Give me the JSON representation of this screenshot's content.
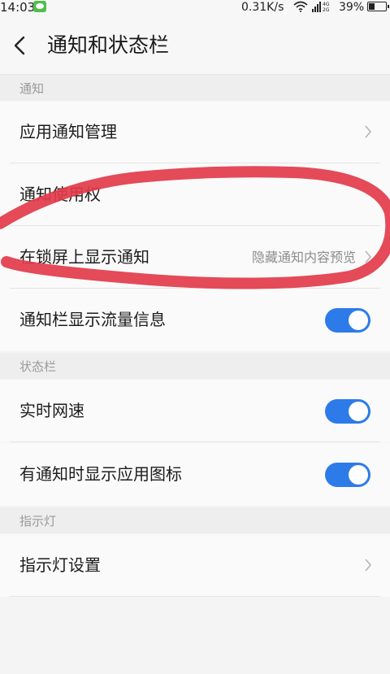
{
  "status_bar": {
    "time": "14:03",
    "network_speed": "0.31K/s",
    "battery": "39%",
    "battery_level": 0.39
  },
  "nav": {
    "title": "通知和状态栏"
  },
  "sections": {
    "notification": {
      "header": "通知",
      "app_notification_manage": "应用通知管理",
      "notification_access": "通知使用权",
      "lockscreen_label": "在锁屏上显示通知",
      "lockscreen_value": "隐藏通知内容预览",
      "traffic_info": "通知栏显示流量信息",
      "traffic_info_on": true
    },
    "status_bar": {
      "header": "状态栏",
      "realtime_speed": "实时网速",
      "realtime_speed_on": true,
      "show_app_icon": "有通知时显示应用图标",
      "show_app_icon_on": true
    },
    "indicator": {
      "header": "指示灯",
      "indicator_settings": "指示灯设置"
    }
  },
  "colors": {
    "toggle_on": "#2d7be8",
    "annotation_stroke": "#e23b4a"
  },
  "icons": [
    "wechat-icon",
    "wifi-icon",
    "signal-icon",
    "battery-icon",
    "back-icon",
    "chevron-right-icon"
  ]
}
